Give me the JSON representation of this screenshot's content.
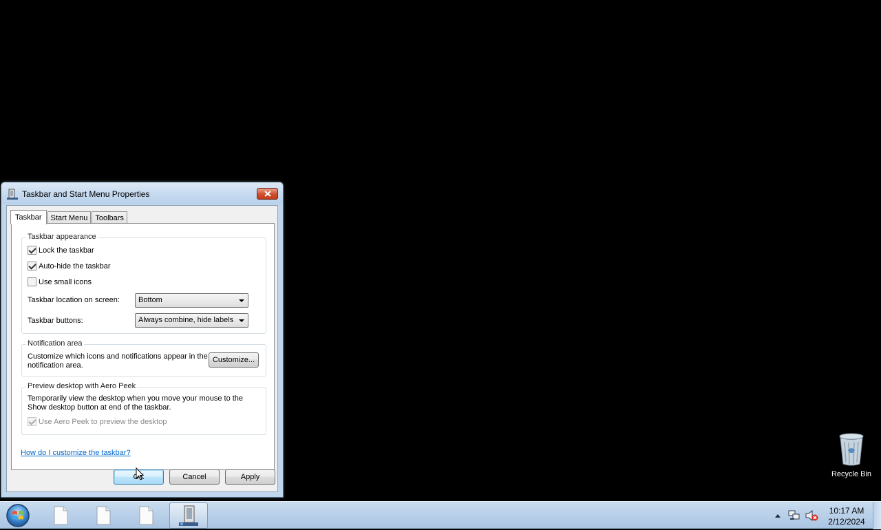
{
  "window": {
    "title": "Taskbar and Start Menu Properties",
    "tabs": [
      {
        "label": "Taskbar",
        "active": true
      },
      {
        "label": "Start Menu",
        "active": false
      },
      {
        "label": "Toolbars",
        "active": false
      }
    ]
  },
  "taskbar_tab": {
    "appearance": {
      "title": "Taskbar appearance",
      "lock_label": "Lock the taskbar",
      "lock_checked": true,
      "autohide_label": "Auto-hide the taskbar",
      "autohide_checked": true,
      "small_icons_label": "Use small icons",
      "small_icons_checked": false,
      "location_label": "Taskbar location on screen:",
      "location_value": "Bottom",
      "buttons_label": "Taskbar buttons:",
      "buttons_value": "Always combine, hide labels"
    },
    "notification": {
      "title": "Notification area",
      "description": "Customize which icons and notifications appear in the notification area.",
      "customize_label": "Customize..."
    },
    "aero_peek": {
      "title": "Preview desktop with Aero Peek",
      "description": "Temporarily view the desktop when you move your mouse to the Show desktop button at end of the taskbar.",
      "use_label": "Use Aero Peek to preview the desktop",
      "use_checked": true,
      "use_enabled": false
    },
    "help_link": "How do I customize the taskbar?"
  },
  "buttons": {
    "ok": "OK",
    "cancel": "Cancel",
    "apply": "Apply"
  },
  "desktop": {
    "recycle_bin_label": "Recycle Bin"
  },
  "system_taskbar": {
    "clock_time": "10:17 AM",
    "clock_date": "2/12/2024",
    "pinned_icons": [
      "document-icon",
      "document-icon",
      "document-icon",
      "taskbar-properties-icon"
    ]
  }
}
